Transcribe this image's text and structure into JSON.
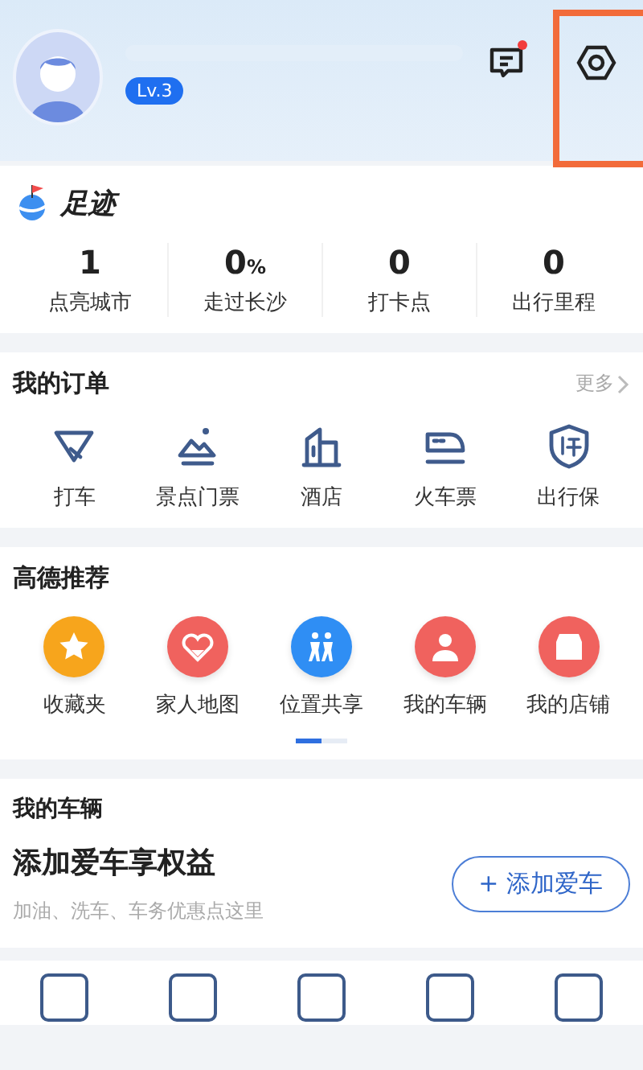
{
  "profile": {
    "level_badge": "Lv.3",
    "has_unread_message": true,
    "settings_highlighted": true
  },
  "footprint": {
    "title": "足迹",
    "stats": [
      {
        "value": "1",
        "label": "点亮城市"
      },
      {
        "value": "0",
        "unit": "%",
        "label": "走过长沙"
      },
      {
        "value": "0",
        "label": "打卡点"
      },
      {
        "value": "0",
        "label": "出行里程"
      }
    ]
  },
  "orders": {
    "title": "我的订单",
    "more": "更多",
    "items": [
      {
        "kind": "taxi",
        "label": "打车"
      },
      {
        "kind": "scenery",
        "label": "景点门票"
      },
      {
        "kind": "hotel",
        "label": "酒店"
      },
      {
        "kind": "train",
        "label": "火车票"
      },
      {
        "kind": "insurance",
        "label": "出行保"
      }
    ]
  },
  "recommend": {
    "title": "高德推荐",
    "items": [
      {
        "kind": "star",
        "label": "收藏夹",
        "color": "#f7a51c"
      },
      {
        "kind": "family",
        "label": "家人地图",
        "color": "#f0625e"
      },
      {
        "kind": "share",
        "label": "位置共享",
        "color": "#2f8ef4"
      },
      {
        "kind": "person",
        "label": "我的车辆",
        "color": "#f0625e"
      },
      {
        "kind": "shop",
        "label": "我的店铺",
        "color": "#f0625e"
      }
    ],
    "pager": [
      {
        "selected": true
      },
      {
        "selected": false
      }
    ]
  },
  "vehicle": {
    "title": "我的车辆",
    "headline": "添加爱车享权益",
    "subtitle": "加油、洗车、车务优惠点这里",
    "button": "+ 添加爱车"
  }
}
